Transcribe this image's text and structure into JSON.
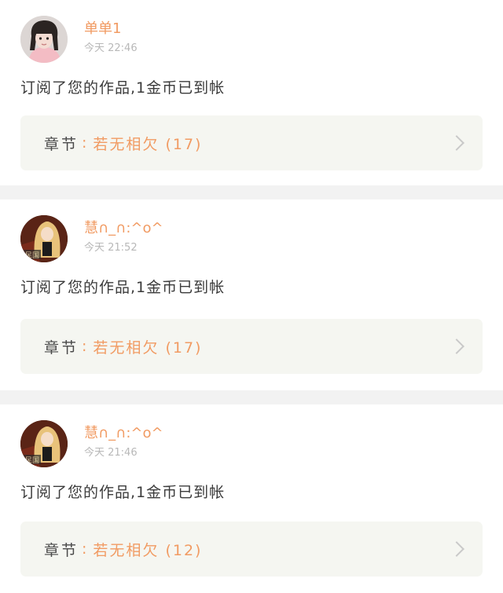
{
  "notifications": [
    {
      "user_name": "单单1",
      "time": "今天 22:46",
      "message": "订阅了您的作品,1金币已到帐",
      "chapter_label": "章节",
      "chapter_sep": ":",
      "chapter_title": "若无相欠 (17)",
      "avatar": "avatar-girl-photo"
    },
    {
      "user_name": "慧∩_∩:^o^",
      "time": "今天 21:52",
      "message": "订阅了您的作品,1金币已到帐",
      "chapter_label": "章节",
      "chapter_sep": ":",
      "chapter_title": "若无相欠 (17)",
      "avatar": "avatar-anime-girl"
    },
    {
      "user_name": "慧∩_∩:^o^",
      "time": "今天 21:46",
      "message": "订阅了您的作品,1金币已到帐",
      "chapter_label": "章节",
      "chapter_sep": ":",
      "chapter_title": "若无相欠 (12)",
      "avatar": "avatar-anime-girl"
    }
  ],
  "colors": {
    "accent": "#f19b63",
    "timestamp": "#b8b8b8",
    "chapter_background": "#f5f6f1",
    "separator": "#f2f2f2"
  },
  "icons": {
    "chevron": "chevron-right-icon"
  }
}
